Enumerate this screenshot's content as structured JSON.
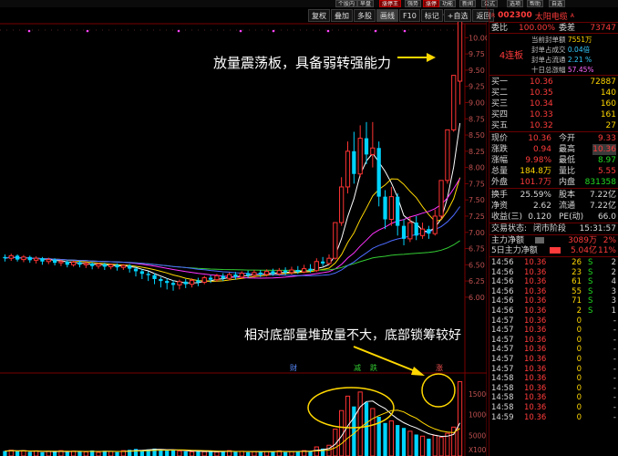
{
  "top_menu": [
    "个股内",
    "早盘",
    "涨停王",
    "强势",
    "涨停",
    "功能",
    "新闻",
    "公式",
    "选项",
    "帮助",
    "自选"
  ],
  "toolbar": {
    "buttons": [
      "复权",
      "叠加",
      "多股",
      "画线",
      "F10",
      "标记",
      "+自选",
      "返回"
    ]
  },
  "stock": {
    "code": "002300",
    "name": "太阳电缆",
    "flag": "R",
    "mark": "A"
  },
  "quote": {
    "weibi_label": "委比",
    "weibi": "100.00%",
    "weicha_label": "委差",
    "weicha": "73747",
    "limit_badge": "4连板",
    "feng_labels": [
      "当前封单额",
      "封单占成交",
      "封单占流通",
      "十日总涨幅"
    ],
    "feng_values": [
      "7551万",
      "0.04倍",
      "2.21 %",
      "57.45%"
    ],
    "buy": [
      {
        "label": "买一",
        "price": "10.36",
        "vol": "72887"
      },
      {
        "label": "买二",
        "price": "10.35",
        "vol": "140"
      },
      {
        "label": "买三",
        "price": "10.34",
        "vol": "160"
      },
      {
        "label": "买四",
        "price": "10.33",
        "vol": "161"
      },
      {
        "label": "买五",
        "price": "10.32",
        "vol": "27"
      }
    ],
    "stats": [
      {
        "l1": "现价",
        "v1": "10.36",
        "l2": "今开",
        "v2": "9.33"
      },
      {
        "l1": "涨跌",
        "v1": "0.94",
        "l2": "最高",
        "v2": "10.36"
      },
      {
        "l1": "涨幅",
        "v1": "9.98%",
        "l2": "最低",
        "v2": "8.97"
      },
      {
        "l1": "总量",
        "v1": "184.8万",
        "l2": "量比",
        "v2": "5.55"
      },
      {
        "l1": "外盘",
        "v1": "101.7万",
        "l2": "内盘",
        "v2": "831358"
      }
    ],
    "fund": [
      {
        "l1": "换手",
        "v1": "25.59%",
        "l2": "股本",
        "v2": "7.22亿"
      },
      {
        "l1": "净资",
        "v1": "2.62",
        "l2": "流通",
        "v2": "7.22亿"
      },
      {
        "l1": "收益(三)",
        "v1": "0.120",
        "l2": "PE(动)",
        "v2": "66.0"
      }
    ],
    "status_label": "交易状态:",
    "status_value": "闭市阶段",
    "status_time": "15:31:57",
    "main_net_label": "主力净额",
    "main_net_value": "3089万",
    "main_net_pct": "2%",
    "main5_label": "5日主力净额",
    "main5_value": "5.04亿",
    "main5_pct": "11%"
  },
  "ticks": [
    {
      "t": "14:56",
      "p": "10.36",
      "v": "26",
      "d": "S",
      "n": "2"
    },
    {
      "t": "14:56",
      "p": "10.36",
      "v": "23",
      "d": "S",
      "n": "2"
    },
    {
      "t": "14:56",
      "p": "10.36",
      "v": "61",
      "d": "S",
      "n": "4"
    },
    {
      "t": "14:56",
      "p": "10.36",
      "v": "55",
      "d": "S",
      "n": "3"
    },
    {
      "t": "14:56",
      "p": "10.36",
      "v": "71",
      "d": "S",
      "n": "3"
    },
    {
      "t": "14:56",
      "p": "10.36",
      "v": "2",
      "d": "S",
      "n": "1"
    },
    {
      "t": "14:57",
      "p": "10.36",
      "v": "0",
      "d": "",
      "n": "-"
    },
    {
      "t": "14:57",
      "p": "10.36",
      "v": "0",
      "d": "",
      "n": "-"
    },
    {
      "t": "14:57",
      "p": "10.36",
      "v": "0",
      "d": "",
      "n": "-"
    },
    {
      "t": "14:57",
      "p": "10.36",
      "v": "0",
      "d": "",
      "n": "-"
    },
    {
      "t": "14:57",
      "p": "10.36",
      "v": "0",
      "d": "",
      "n": "-"
    },
    {
      "t": "14:57",
      "p": "10.36",
      "v": "0",
      "d": "",
      "n": "-"
    },
    {
      "t": "14:58",
      "p": "10.36",
      "v": "0",
      "d": "",
      "n": "-"
    },
    {
      "t": "14:58",
      "p": "10.36",
      "v": "0",
      "d": "",
      "n": "-"
    },
    {
      "t": "14:58",
      "p": "10.36",
      "v": "0",
      "d": "",
      "n": "-"
    },
    {
      "t": "14:58",
      "p": "10.36",
      "v": "0",
      "d": "",
      "n": "-"
    },
    {
      "t": "14:59",
      "p": "10.36",
      "v": "0",
      "d": "",
      "n": "-"
    }
  ],
  "annotations": {
    "top": "放量震荡板，具备弱转强能力",
    "bottom": "相对底部量堆放量不大，底部锁筹较好"
  },
  "chart_data": {
    "type": "candlestick",
    "price_axis": [
      "10.00",
      "9.75",
      "9.50",
      "9.25",
      "9.00",
      "8.75",
      "8.50",
      "8.25",
      "8.00",
      "7.75",
      "7.50",
      "7.25",
      "7.00",
      "6.75",
      "6.50",
      "6.25",
      "6.00"
    ],
    "price_range": [
      5.9,
      10.3
    ],
    "high_label": "10.36",
    "volume_axis": [
      "15000",
      "10000",
      "5000",
      "X100"
    ],
    "volume_range": [
      0,
      19000
    ],
    "event_marks": [
      "财",
      "减",
      "跌",
      "涨"
    ],
    "candles": [
      [
        6.62,
        6.6,
        6.66,
        6.55
      ],
      [
        6.6,
        6.64,
        6.67,
        6.56
      ],
      [
        6.64,
        6.58,
        6.66,
        6.55
      ],
      [
        6.58,
        6.62,
        6.65,
        6.54
      ],
      [
        6.62,
        6.57,
        6.64,
        6.53
      ],
      [
        6.57,
        6.6,
        6.63,
        6.52
      ],
      [
        6.6,
        6.55,
        6.62,
        6.5
      ],
      [
        6.55,
        6.58,
        6.61,
        6.51
      ],
      [
        6.58,
        6.53,
        6.6,
        6.49
      ],
      [
        6.53,
        6.55,
        6.58,
        6.48
      ],
      [
        6.55,
        6.5,
        6.57,
        6.46
      ],
      [
        6.5,
        6.54,
        6.56,
        6.47
      ],
      [
        6.54,
        6.5,
        6.56,
        6.46
      ],
      [
        6.5,
        6.52,
        6.55,
        6.45
      ],
      [
        6.52,
        6.48,
        6.54,
        6.43
      ],
      [
        6.48,
        6.51,
        6.53,
        6.44
      ],
      [
        6.51,
        6.47,
        6.53,
        6.42
      ],
      [
        6.47,
        6.5,
        6.52,
        6.43
      ],
      [
        6.5,
        6.46,
        6.52,
        6.41
      ],
      [
        6.46,
        6.49,
        6.51,
        6.42
      ],
      [
        6.49,
        6.44,
        6.51,
        6.38
      ],
      [
        6.44,
        6.4,
        6.47,
        6.32
      ],
      [
        6.4,
        6.36,
        6.43,
        6.28
      ],
      [
        6.36,
        6.34,
        6.4,
        6.25
      ],
      [
        6.34,
        6.28,
        6.37,
        6.2
      ],
      [
        6.28,
        6.25,
        6.31,
        6.15
      ],
      [
        6.25,
        6.22,
        6.29,
        6.12
      ],
      [
        6.22,
        6.19,
        6.26,
        6.1
      ],
      [
        6.19,
        6.24,
        6.27,
        6.12
      ],
      [
        6.24,
        6.2,
        6.28,
        6.14
      ],
      [
        6.2,
        6.26,
        6.29,
        6.15
      ],
      [
        6.26,
        6.23,
        6.3,
        6.17
      ],
      [
        6.23,
        6.3,
        6.33,
        6.2
      ],
      [
        6.3,
        6.27,
        6.34,
        6.22
      ],
      [
        6.27,
        6.33,
        6.36,
        6.24
      ],
      [
        6.33,
        6.29,
        6.37,
        6.25
      ],
      [
        6.29,
        6.35,
        6.38,
        6.26
      ],
      [
        6.35,
        6.31,
        6.39,
        6.27
      ],
      [
        6.31,
        6.37,
        6.4,
        6.28
      ],
      [
        6.37,
        6.34,
        6.41,
        6.3
      ],
      [
        6.34,
        6.38,
        6.42,
        6.3
      ],
      [
        6.38,
        6.35,
        6.42,
        6.31
      ],
      [
        6.35,
        6.4,
        6.43,
        6.32
      ],
      [
        6.4,
        6.36,
        6.44,
        6.33
      ],
      [
        6.36,
        6.41,
        6.45,
        6.33
      ],
      [
        6.41,
        6.38,
        6.46,
        6.34
      ],
      [
        6.38,
        6.42,
        6.47,
        6.35
      ],
      [
        6.42,
        6.39,
        6.48,
        6.36
      ],
      [
        6.39,
        6.44,
        6.5,
        6.37
      ],
      [
        6.44,
        6.41,
        6.51,
        6.38
      ],
      [
        6.41,
        6.55,
        6.6,
        6.39
      ],
      [
        6.55,
        6.52,
        6.62,
        6.48
      ],
      [
        6.52,
        6.6,
        6.66,
        6.5
      ],
      [
        6.6,
        7.15,
        7.15,
        6.58
      ],
      [
        7.15,
        7.7,
        7.85,
        7.1
      ],
      [
        7.7,
        8.25,
        8.4,
        7.6
      ],
      [
        8.25,
        7.9,
        8.55,
        7.75
      ],
      [
        7.9,
        8.45,
        8.65,
        7.85
      ],
      [
        8.45,
        8.2,
        8.7,
        8.05
      ],
      [
        8.2,
        8.3,
        8.7,
        8.0
      ],
      [
        8.3,
        7.55,
        8.4,
        7.4
      ],
      [
        7.55,
        7.2,
        7.65,
        7.05
      ],
      [
        7.2,
        7.55,
        7.7,
        7.1
      ],
      [
        7.55,
        7.1,
        7.6,
        6.95
      ],
      [
        7.1,
        6.9,
        7.2,
        6.8
      ],
      [
        6.9,
        7.15,
        7.25,
        6.85
      ],
      [
        7.15,
        6.95,
        7.25,
        6.88
      ],
      [
        6.95,
        7.05,
        7.15,
        6.9
      ],
      [
        7.05,
        6.98,
        7.1,
        6.9
      ],
      [
        6.98,
        7.25,
        7.35,
        6.95
      ],
      [
        7.25,
        7.8,
        7.8,
        7.2
      ],
      [
        7.8,
        8.58,
        8.58,
        7.75
      ],
      [
        8.58,
        9.42,
        9.42,
        8.55
      ],
      [
        9.33,
        10.36,
        10.36,
        8.97
      ]
    ],
    "volumes": [
      1200,
      1400,
      1100,
      1300,
      1000,
      1250,
      900,
      1150,
      1050,
      1300,
      950,
      1200,
      1100,
      1000,
      1350,
      900,
      1250,
      1100,
      950,
      1300,
      1500,
      1700,
      1400,
      1600,
      1800,
      1500,
      1300,
      1400,
      1200,
      1100,
      1000,
      1150,
      1050,
      1200,
      950,
      1100,
      1300,
      1000,
      1150,
      900,
      1050,
      1200,
      1100,
      1000,
      1250,
      950,
      1100,
      1200,
      1300,
      1150,
      2200,
      1800,
      2600,
      6500,
      11000,
      14500,
      12000,
      15500,
      13000,
      11500,
      9500,
      8000,
      8500,
      7500,
      6800,
      6000,
      5200,
      4800,
      4200,
      5000,
      4500,
      5500,
      7000,
      18000
    ],
    "limit_up_days": [
      53,
      54,
      55,
      70,
      71,
      72,
      73
    ]
  }
}
